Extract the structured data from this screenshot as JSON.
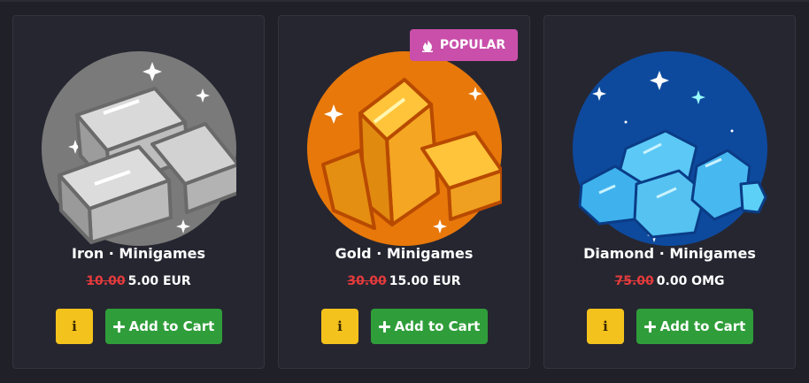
{
  "products": [
    {
      "title": "Iron · Minigames",
      "old_price": "10.00",
      "price": "5.00 EUR",
      "image_icon": "iron-bars-icon",
      "info_label": "i",
      "cart_label": "Add to Cart"
    },
    {
      "title": "Gold · Minigames",
      "old_price": "30.00",
      "price": "15.00 EUR",
      "image_icon": "gold-bars-icon",
      "info_label": "i",
      "cart_label": "Add to Cart",
      "badge": "POPULAR"
    },
    {
      "title": "Diamond · Minigames",
      "old_price": "75.00",
      "price": "0.00 OMG",
      "image_icon": "diamonds-icon",
      "info_label": "i",
      "cart_label": "Add to Cart"
    }
  ],
  "colors": {
    "background": "#202029",
    "card": "#262631",
    "info_button": "#f4c21c",
    "cart_button": "#2f9e3a",
    "badge": "#c94faa",
    "old_price": "#e53b3b"
  }
}
